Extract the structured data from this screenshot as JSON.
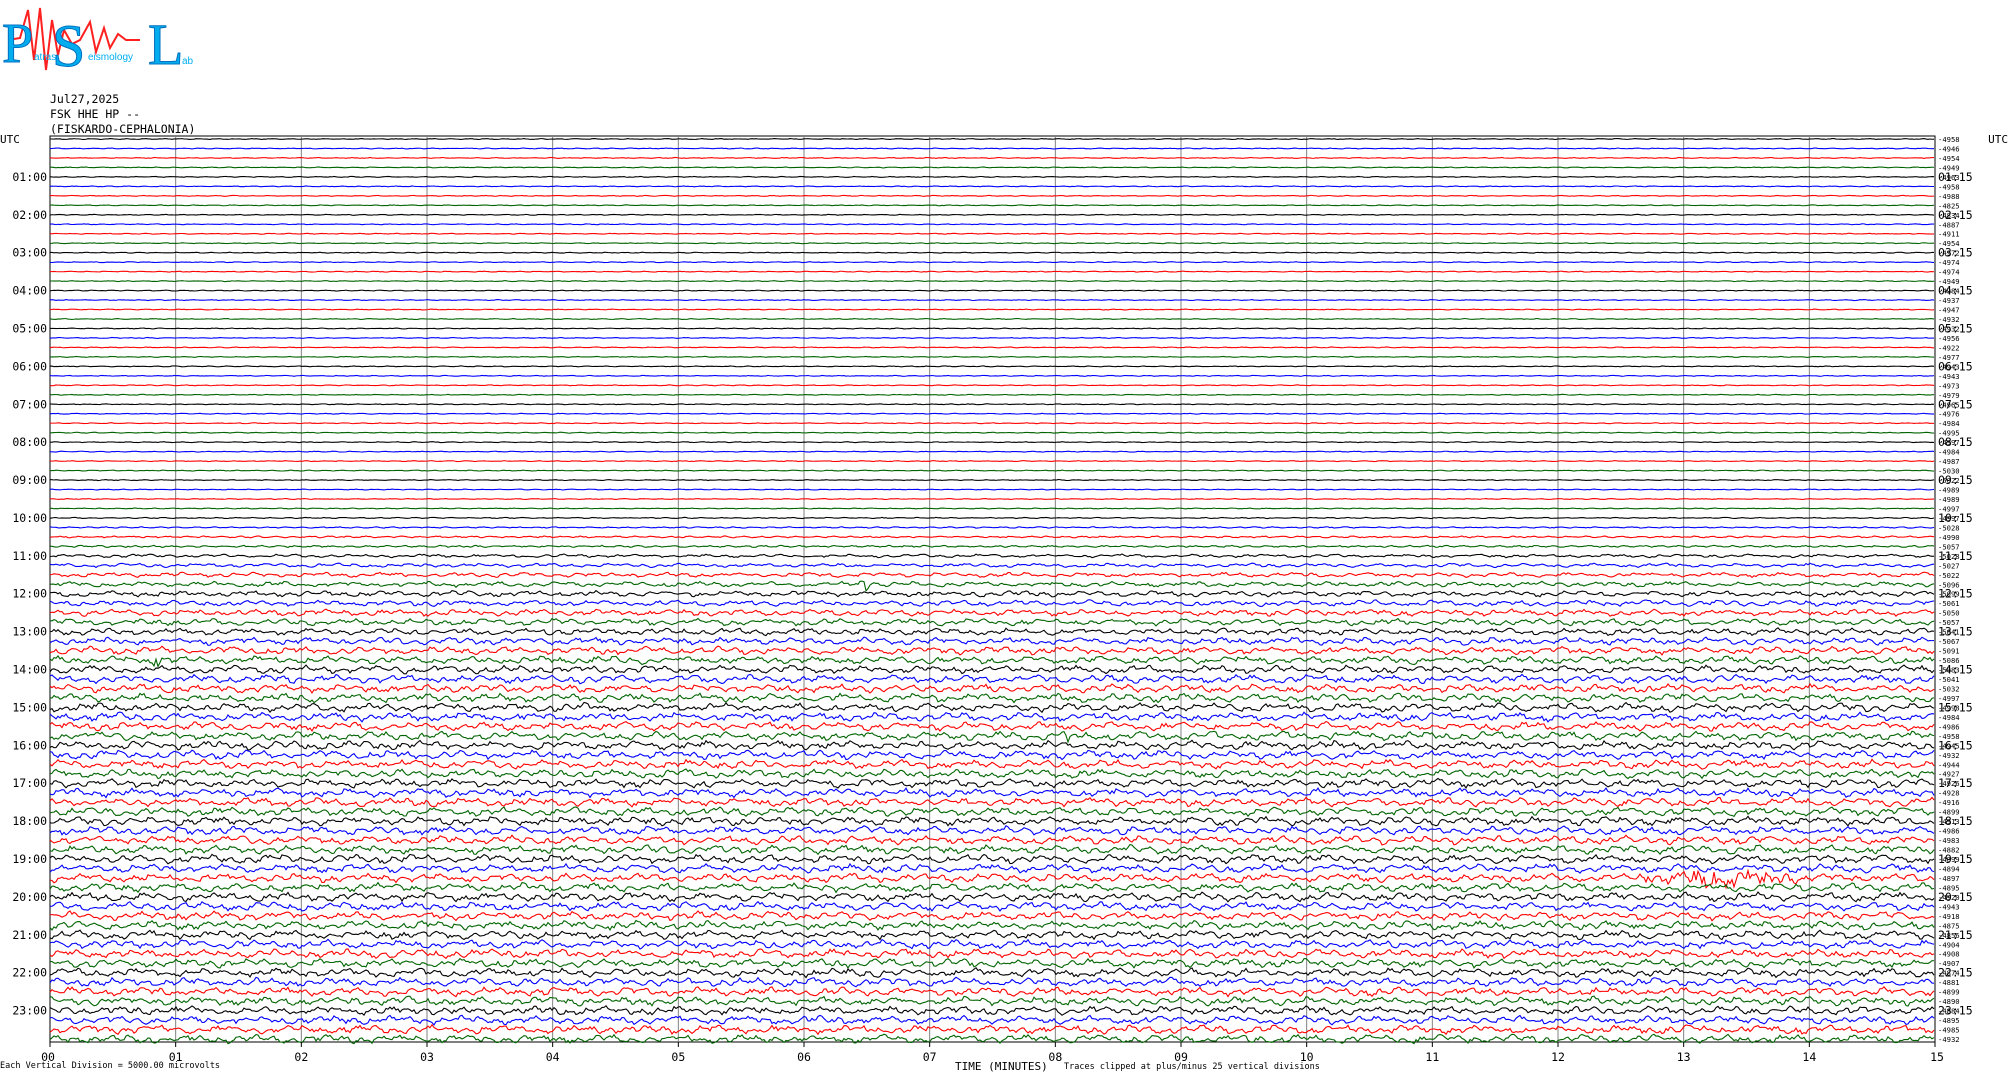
{
  "logo": {
    "letters": [
      "P",
      "S",
      "L"
    ],
    "small_text": [
      "atras",
      "eismology",
      "ab"
    ]
  },
  "header": {
    "date": "Jul27,2025",
    "station": "FSK HHE HP --",
    "location": "(FISKARDO-CEPHALONIA)"
  },
  "footer": {
    "left_note": "Each Vertical Division = 5000.00 microvolts",
    "axis_title": "TIME (MINUTES)",
    "clip_note": "Traces clipped at plus/minus 25 vertical divisions"
  },
  "colors": {
    "trace_cycle": [
      "#000000",
      "#0000ff",
      "#ff0000",
      "#006400"
    ],
    "grid": "#808080"
  },
  "chart_data": {
    "type": "line",
    "title": "",
    "xlabel": "TIME (MINUTES)",
    "ylabel": "",
    "x_ticks": [
      "00",
      "01",
      "02",
      "03",
      "04",
      "05",
      "06",
      "07",
      "08",
      "09",
      "10",
      "11",
      "12",
      "13",
      "14",
      "15"
    ],
    "xlim": [
      0,
      15
    ],
    "grid": true,
    "left_axis_label": "UTC",
    "right_axis_label": "UTC",
    "left_hour_labels": [
      "01:00",
      "02:00",
      "03:00",
      "04:00",
      "05:00",
      "06:00",
      "07:00",
      "08:00",
      "09:00",
      "10:00",
      "11:00",
      "12:00",
      "13:00",
      "14:00",
      "15:00",
      "16:00",
      "17:00",
      "18:00",
      "19:00",
      "20:00",
      "21:00",
      "22:00",
      "23:00"
    ],
    "right_hour_labels": [
      "01:15",
      "02:15",
      "03:15",
      "04:15",
      "05:15",
      "06:15",
      "07:15",
      "08:15",
      "09:15",
      "10:15",
      "11:15",
      "12:15",
      "13:15",
      "14:15",
      "15:15",
      "16:15",
      "17:15",
      "18:15",
      "19:15",
      "20:15",
      "21:15",
      "22:15",
      "23:15"
    ],
    "trace_count": 96,
    "trace_interval_minutes": 15,
    "trace_offsets": [
      -4958,
      -4946,
      -4954,
      -4949,
      -4963,
      -4958,
      -4988,
      -4825,
      -4834,
      -4887,
      -4911,
      -4954,
      -4972,
      -4974,
      -4974,
      -4949,
      -4984,
      -4937,
      -4947,
      -4932,
      -4932,
      -4956,
      -4922,
      -4977,
      -4943,
      -4943,
      -4973,
      -4979,
      -4965,
      -4976,
      -4984,
      -4995,
      -4997,
      -4984,
      -4987,
      -5030,
      -5022,
      -4989,
      -4989,
      -4997,
      -4997,
      -5028,
      -4990,
      -5057,
      -5028,
      -5027,
      -5022,
      -5096,
      -5099,
      -5061,
      -5050,
      -5057,
      -5041,
      -5067,
      -5091,
      -5086,
      -5083,
      -5041,
      -5032,
      -4997,
      -4998,
      -4984,
      -4986,
      -4958,
      -4945,
      -4932,
      -4944,
      -4927,
      -4926,
      -4928,
      -4916,
      -4899,
      -4913,
      -4986,
      -4983,
      -4882,
      -4899,
      -4894,
      -4897,
      -4895,
      -4920,
      -4943,
      -4918,
      -4875,
      -4856,
      -4904,
      -4908,
      -4907,
      -4874,
      -4881,
      -4899,
      -4890,
      -4884,
      -4895,
      -4985,
      -4932
    ],
    "noise_levels": [
      0.4,
      0.4,
      0.4,
      0.4,
      0.4,
      0.4,
      0.4,
      0.4,
      0.4,
      0.4,
      0.4,
      0.4,
      0.4,
      0.4,
      0.4,
      0.4,
      0.4,
      0.4,
      0.4,
      0.4,
      0.4,
      0.4,
      0.4,
      0.4,
      0.4,
      0.4,
      0.4,
      0.4,
      0.4,
      0.4,
      0.4,
      0.4,
      0.4,
      0.4,
      0.4,
      0.4,
      0.4,
      0.4,
      0.4,
      0.4,
      0.5,
      0.6,
      0.8,
      0.9,
      1.1,
      1.3,
      1.5,
      1.7,
      1.9,
      2.0,
      2.1,
      2.2,
      2.3,
      2.4,
      2.5,
      2.6,
      2.6,
      2.7,
      2.7,
      2.8,
      2.8,
      2.8,
      2.8,
      2.8,
      2.8,
      2.8,
      2.8,
      2.8,
      2.8,
      2.8,
      2.8,
      2.8,
      2.8,
      2.8,
      2.8,
      2.8,
      2.8,
      2.8,
      2.8,
      2.8,
      2.8,
      2.8,
      2.8,
      2.8,
      2.8,
      2.8,
      2.8,
      2.8,
      2.8,
      2.8,
      2.8,
      2.8,
      2.8,
      2.8,
      2.8,
      2.8
    ],
    "events": [
      {
        "trace": 47,
        "minute": 6.5,
        "amplitude": 6,
        "duration_min": 0.1
      },
      {
        "trace": 55,
        "minute": 0.85,
        "amplitude": 6,
        "duration_min": 0.1
      },
      {
        "trace": 63,
        "minute": 8.1,
        "amplitude": 9,
        "duration_min": 0.15
      },
      {
        "trace": 78,
        "minute": 13.3,
        "amplitude": 9,
        "duration_min": 0.8
      }
    ]
  }
}
